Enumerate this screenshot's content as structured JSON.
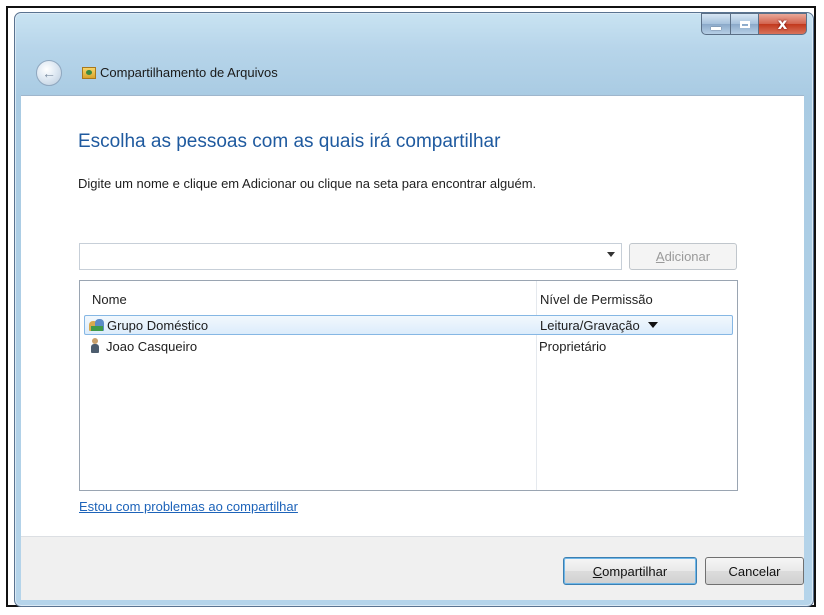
{
  "window": {
    "title": "Compartilhamento de Arquivos",
    "close_symbol": "x",
    "back_symbol": "←"
  },
  "main": {
    "heading": "Escolha as pessoas com as quais irá compartilhar",
    "instruction": "Digite um nome e clique em Adicionar ou clique na seta para encontrar alguém."
  },
  "name_input": {
    "value": "",
    "placeholder": ""
  },
  "add_button": {
    "access_key": "A",
    "label_rest": "dicionar",
    "enabled": false
  },
  "list": {
    "headers": [
      "Nome",
      "Nível de Permissão"
    ],
    "rows": [
      {
        "name": "Grupo Doméstico",
        "permission": "Leitura/Gravação",
        "icon": "homegroup-icon",
        "selected": true
      },
      {
        "name": "Joao Casqueiro",
        "permission": "Proprietário",
        "icon": "user-icon",
        "selected": false
      }
    ]
  },
  "help_link": "Estou com problemas ao compartilhar",
  "footer": {
    "share_access_key": "C",
    "share_label_rest": "ompartilhar",
    "cancel_label": "Cancelar"
  },
  "colors": {
    "heading": "#1f5a9f",
    "link": "#1d63b9",
    "close_button": "#c2381c",
    "selection": "#dcecfb"
  }
}
